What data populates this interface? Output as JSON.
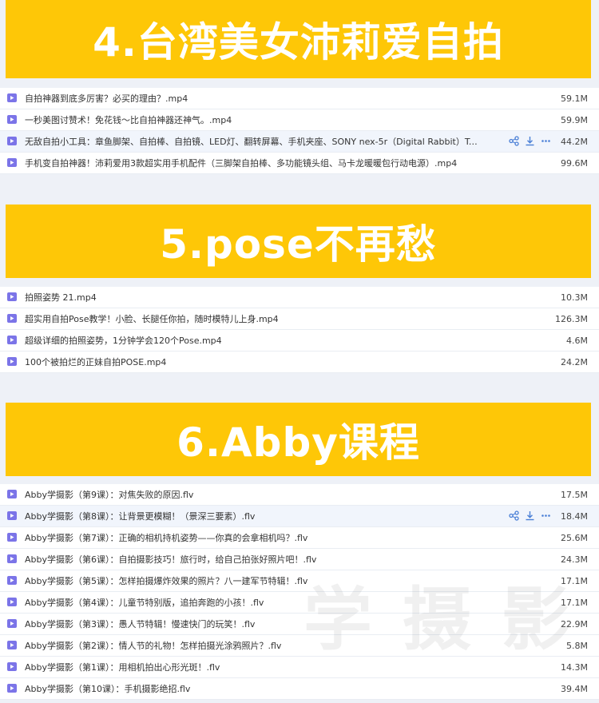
{
  "sections": [
    {
      "title": "4.台湾美女沛莉爱自拍",
      "files": [
        {
          "name": "自拍神器到底多厉害？必买的理由？.mp4",
          "size": "59.1M"
        },
        {
          "name": "一秒美图讨赞术！免花钱～比自拍神器还神气。.mp4",
          "size": "59.9M"
        },
        {
          "name": "无敌自拍小工具：章鱼脚架、自拍棒、自拍镜、LED灯、翻转屏幕、手机夹座、SONY nex-5r（Digital Rabbit）To...",
          "size": "44.2M"
        },
        {
          "name": "手机变自拍神器！沛莉爱用3款超实用手机配件（三脚架自拍棒、多功能镜头组、马卡龙暖暖包行动电源）.mp4",
          "size": "99.6M"
        }
      ]
    },
    {
      "title": "5.pose不再愁",
      "files": [
        {
          "name": "拍照姿势 21.mp4",
          "size": "10.3M"
        },
        {
          "name": "超实用自拍Pose教学！小脸、长腿任你拍，随时模特儿上身.mp4",
          "size": "126.3M"
        },
        {
          "name": "超级详细的拍照姿势，1分钟学会120个Pose.mp4",
          "size": "4.6M"
        },
        {
          "name": "100个被拍烂的正妹自拍POSE.mp4",
          "size": "24.2M"
        }
      ]
    },
    {
      "title": "6.Abby课程",
      "files": [
        {
          "name": "Abby学摄影（第9课）：对焦失败的原因.flv",
          "size": "17.5M"
        },
        {
          "name": "Abby学摄影（第8课）：让背景更模糊！（景深三要素）.flv",
          "size": "18.4M"
        },
        {
          "name": "Abby学摄影（第7课）：正确的相机持机姿势——你真的会拿相机吗？.flv",
          "size": "25.6M"
        },
        {
          "name": "Abby学摄影（第6课）：自拍摄影技巧！旅行时，给自己拍张好照片吧！.flv",
          "size": "24.3M"
        },
        {
          "name": "Abby学摄影（第5课）：怎样拍摄爆炸效果的照片？八一建军节特辑！.flv",
          "size": "17.1M"
        },
        {
          "name": "Abby学摄影（第4课）：儿童节特别版，追拍奔跑的小孩！.flv",
          "size": "17.1M"
        },
        {
          "name": "Abby学摄影（第3课）：愚人节特辑！慢速快门的玩笑！.flv",
          "size": "22.9M"
        },
        {
          "name": "Abby学摄影（第2课）：情人节的礼物！怎样拍摄光涂鸦照片？.flv",
          "size": "5.8M"
        },
        {
          "name": "Abby学摄影（第1课）：用相机拍出心形光斑！.flv",
          "size": "14.3M"
        },
        {
          "name": "Abby学摄影（第10课）：手机摄影绝招.flv",
          "size": "39.4M"
        }
      ]
    }
  ],
  "watermark": "学 摄 影 库",
  "icons": {
    "file": "video-file-icon",
    "share": "share-icon",
    "download": "download-icon",
    "more": "more-icon"
  },
  "colors": {
    "banner": "#fec707",
    "file_icon": "#7b74e8",
    "action_icon": "#4a7fd6"
  }
}
